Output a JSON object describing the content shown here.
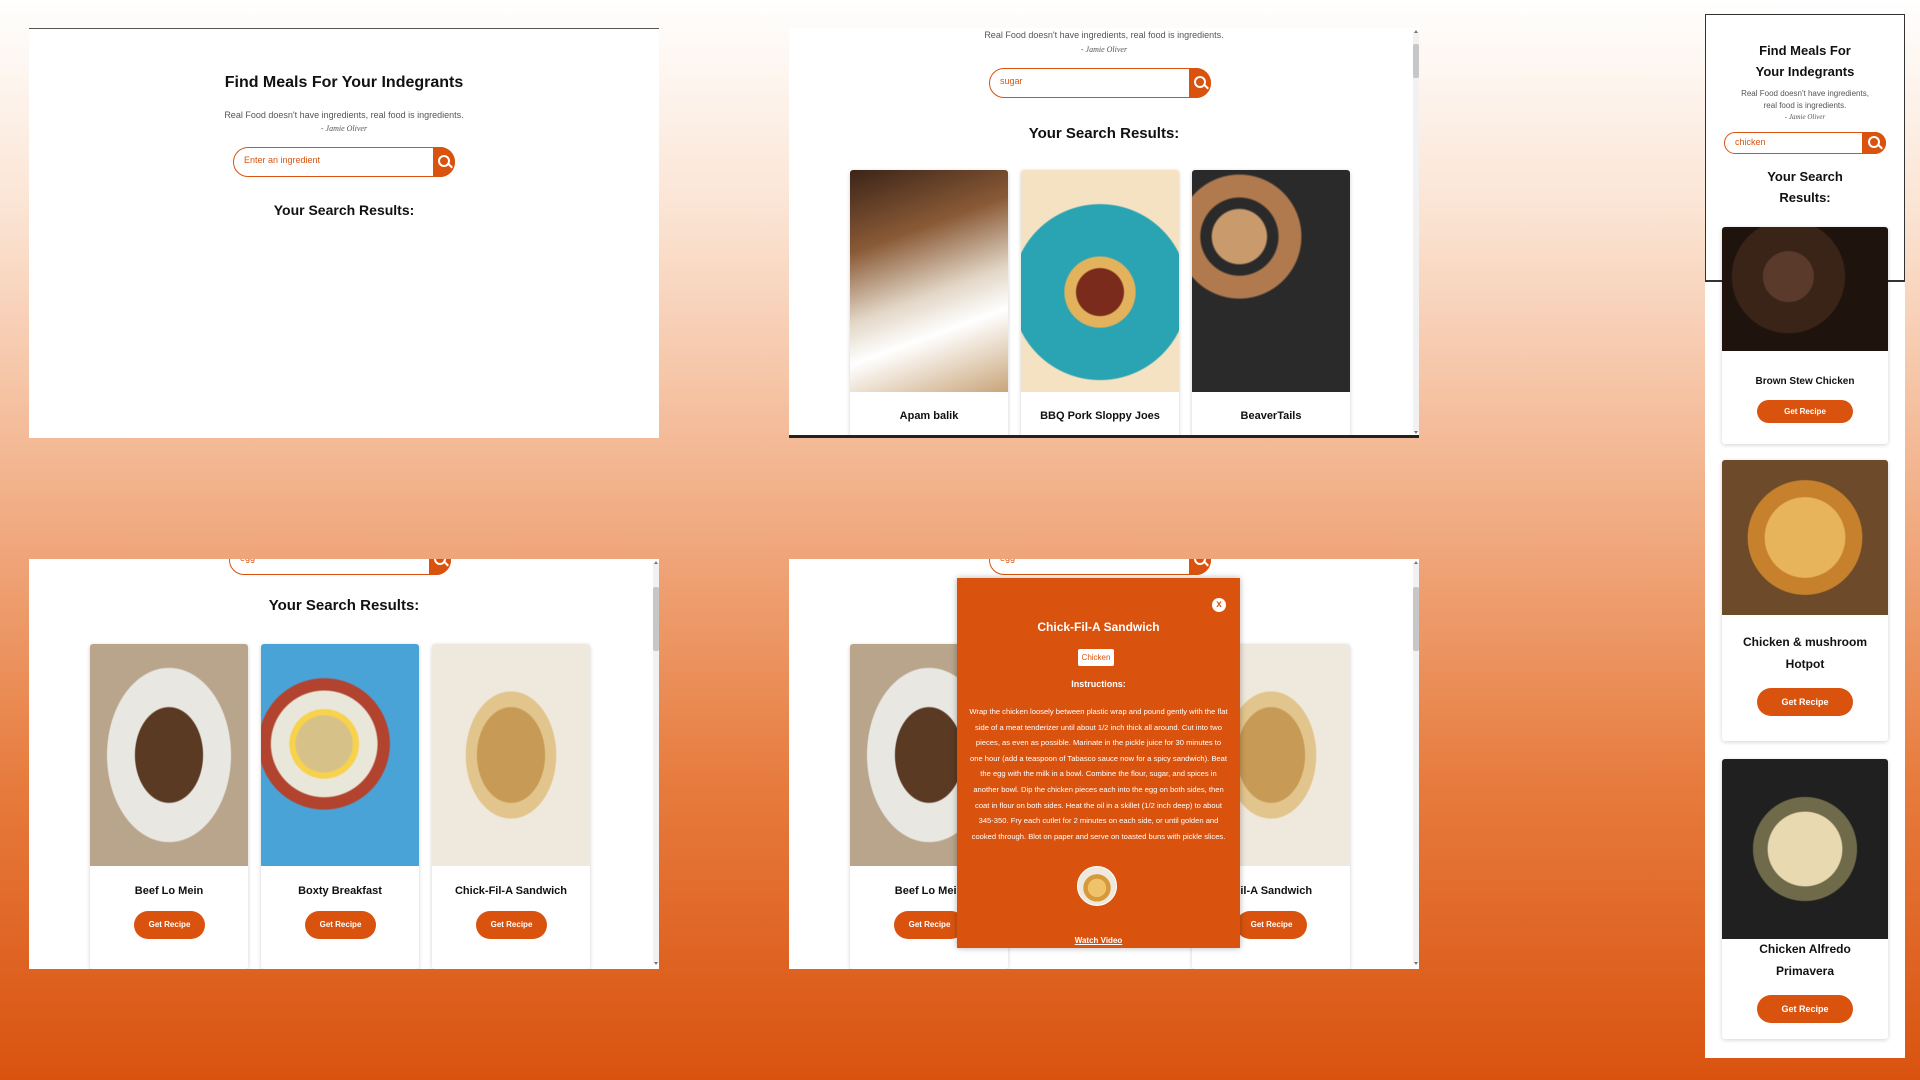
{
  "app": {
    "title": "Find Meals For Your Indegrants",
    "quote": "Real Food doesn't have ingredients, real food is ingredients.",
    "author": "- Jamie Oliver",
    "results_heading": "Your Search Results:",
    "get_recipe_label": "Get Recipe"
  },
  "panels": {
    "empty": {
      "search_placeholder": "Enter an ingredient"
    },
    "sugar": {
      "search_value": "sugar",
      "results": [
        {
          "name": "Apam balik"
        },
        {
          "name": "BBQ Pork Sloppy Joes"
        },
        {
          "name": "BeaverTails"
        }
      ]
    },
    "egg": {
      "search_value": "egg",
      "results": [
        {
          "name": "Beef Lo Mein"
        },
        {
          "name": "Boxty Breakfast"
        },
        {
          "name": "Chick-Fil-A Sandwich"
        }
      ]
    },
    "modal_view": {
      "search_value": "egg",
      "left_card": "Beef Lo Mein",
      "right_card": "-Fil-A Sandwich",
      "modal": {
        "title": "Chick-Fil-A Sandwich",
        "category": "Chicken",
        "instructions_label": "Instructions:",
        "instructions": "Wrap the chicken loosely between plastic wrap and pound gently with the flat side of a meat tenderizer until about 1/2 inch thick all around. Cut into two pieces, as even as possible. Marinate in the pickle juice for 30 minutes to one hour (add a teaspoon of Tabasco sauce now for a spicy sandwich). Beat the egg with the milk in a bowl. Combine the flour, sugar, and spices in another bowl. Dip the chicken pieces each into the egg on both sides, then coat in flour on both sides. Heat the oil in a skillet (1/2 inch deep) to about 345-350. Fry each cutlet for 2 minutes on each side, or until golden and cooked through. Blot on paper and serve on toasted buns with pickle slices.",
        "close_label": "x",
        "video_label": "Watch Video"
      }
    },
    "mobile": {
      "title_line1": "Find Meals For",
      "title_line2": "Your Indegrants",
      "quote_line1": "Real Food doesn't have ingredients,",
      "quote_line2": "real food is ingredients.",
      "search_value": "chicken",
      "results_line1": "Your Search",
      "results_line2": "Results:",
      "results": [
        {
          "line1": "Brown Stew Chicken",
          "line2": ""
        },
        {
          "line1": "Chicken & mushroom",
          "line2": "Hotpot"
        },
        {
          "line1": "Chicken Alfredo",
          "line2": "Primavera"
        }
      ]
    }
  },
  "colors": {
    "accent": "#d9530f",
    "text": "#111111"
  },
  "icons": {
    "search": "search-icon",
    "close": "close-icon"
  }
}
